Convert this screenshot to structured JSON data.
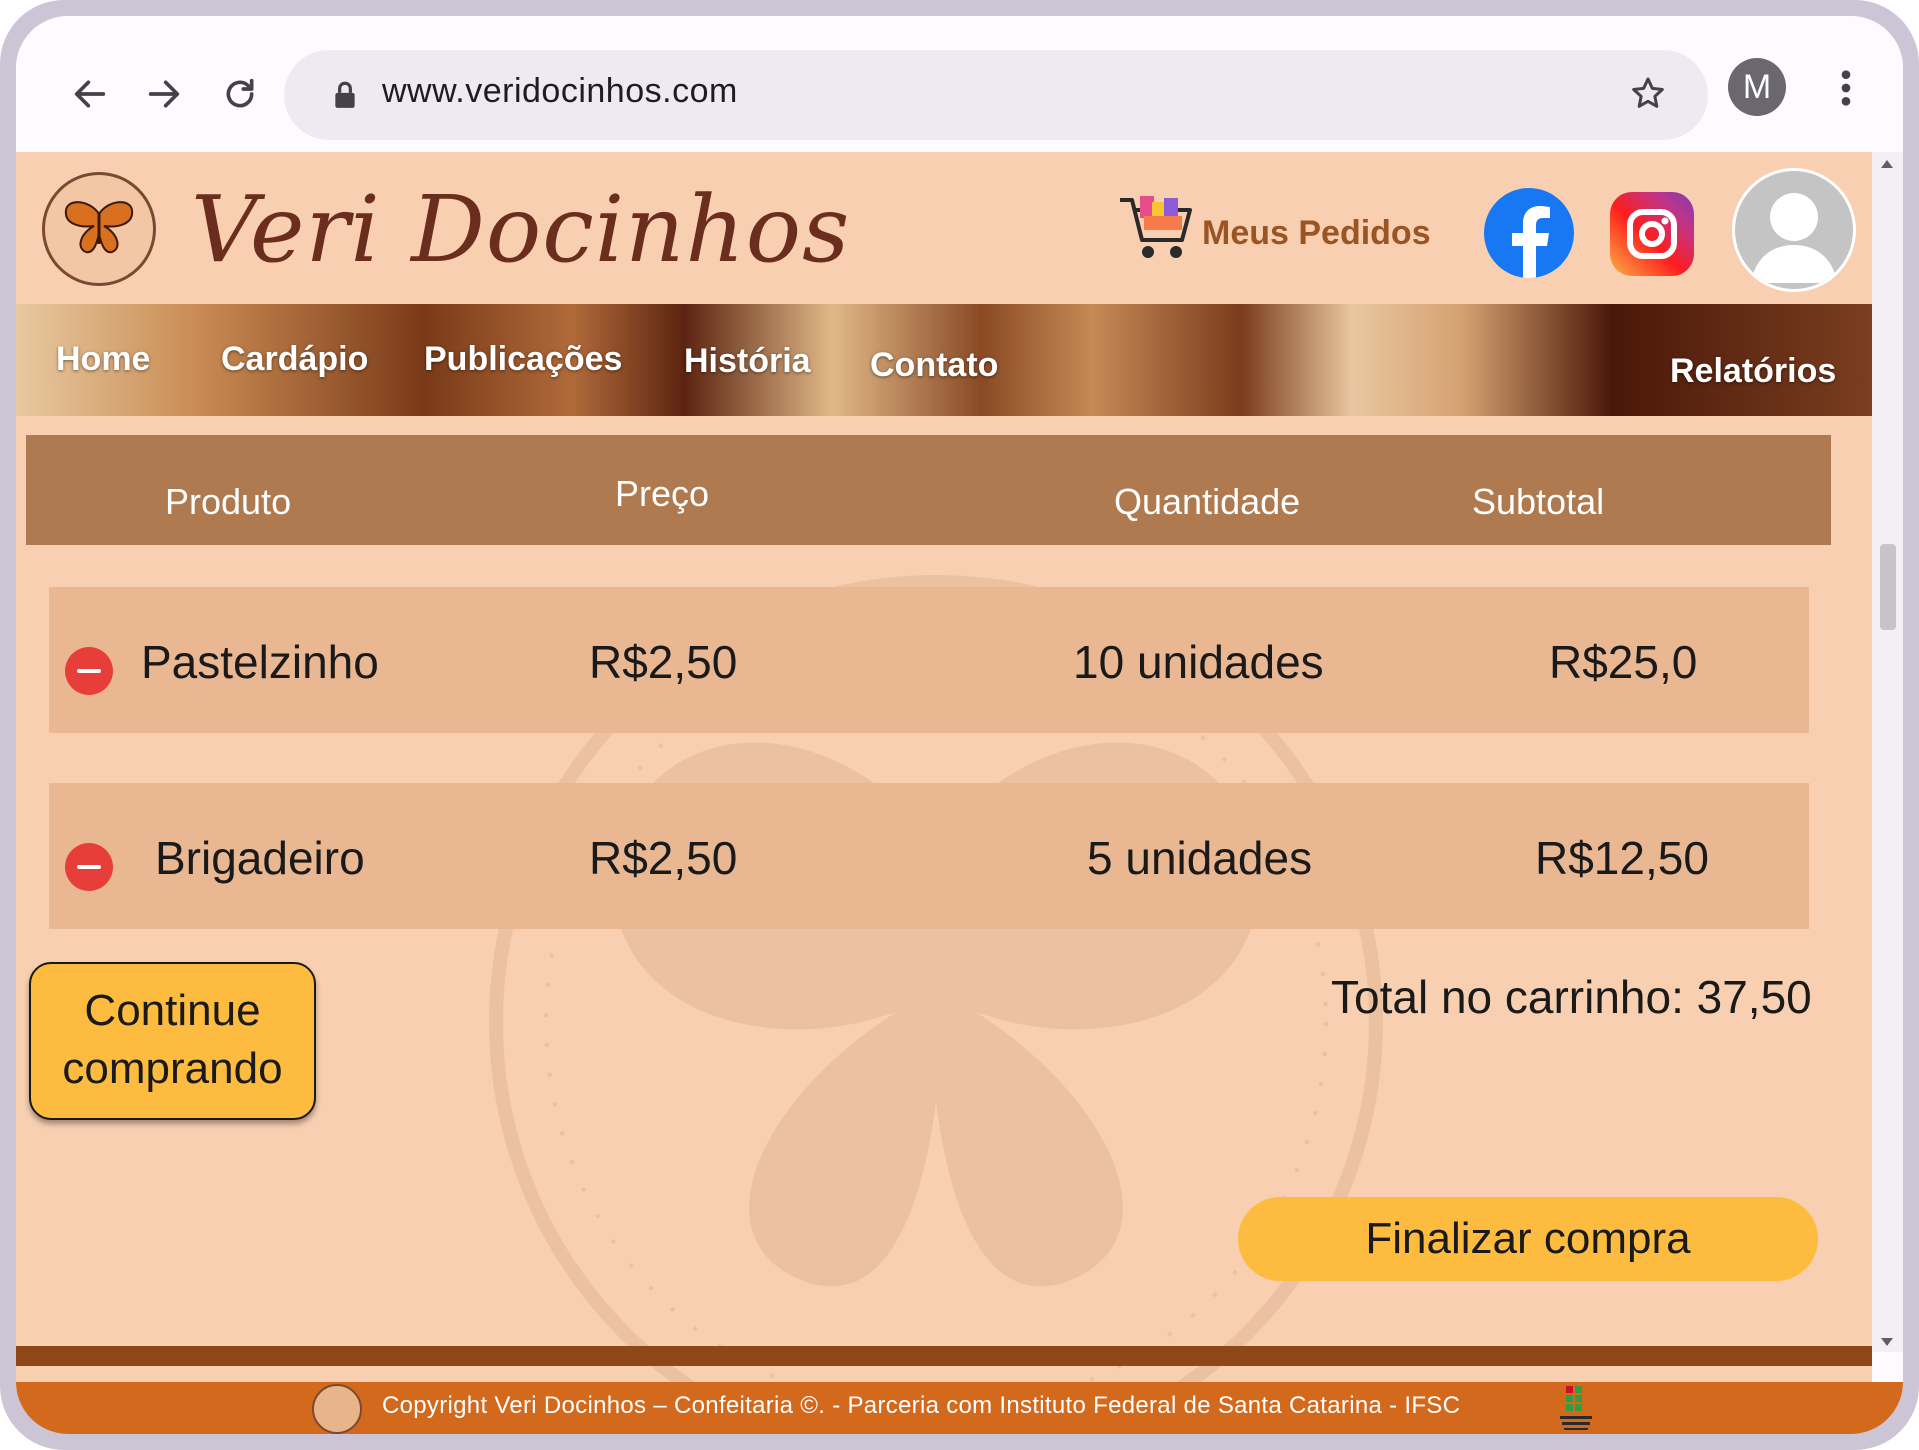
{
  "browser": {
    "url": "www.veridocinhos.com",
    "profile_initial": "M"
  },
  "header": {
    "brand": "Veri Docinhos",
    "meus_pedidos": "Meus Pedidos"
  },
  "menu": {
    "home": "Home",
    "cardapio": "Cardápio",
    "publicacoes": "Publicações",
    "historia": "História",
    "contato": "Contato",
    "relatorios": "Relatórios"
  },
  "cart": {
    "columns": [
      "Produto",
      "Preço",
      "Quantidade",
      "Subtotal"
    ],
    "items": [
      {
        "produto": "Pastelzinho",
        "preco": "R$2,50",
        "quantidade": "10 unidades",
        "subtotal": "R$25,0"
      },
      {
        "produto": "Brigadeiro",
        "preco": "R$2,50",
        "quantidade": "5 unidades",
        "subtotal": "R$12,50"
      }
    ],
    "total": "Total no carrinho: 37,50",
    "continue_line1": "Continue",
    "continue_line2": "comprando",
    "finalizar": "Finalizar compra"
  },
  "footer": {
    "copyright": "Copyright Veri Docinhos – Confeitaria ©. - Parceria com Instituto Federal de Santa Catarina - IFSC"
  },
  "colors": {
    "page_bg": "#f8d0b1",
    "table_header": "#af7a4f",
    "row_bg": "#e9b893",
    "button_yellow": "#fdbc3f",
    "footer_orange": "#d2691d",
    "remove_red": "#e73e3a"
  }
}
